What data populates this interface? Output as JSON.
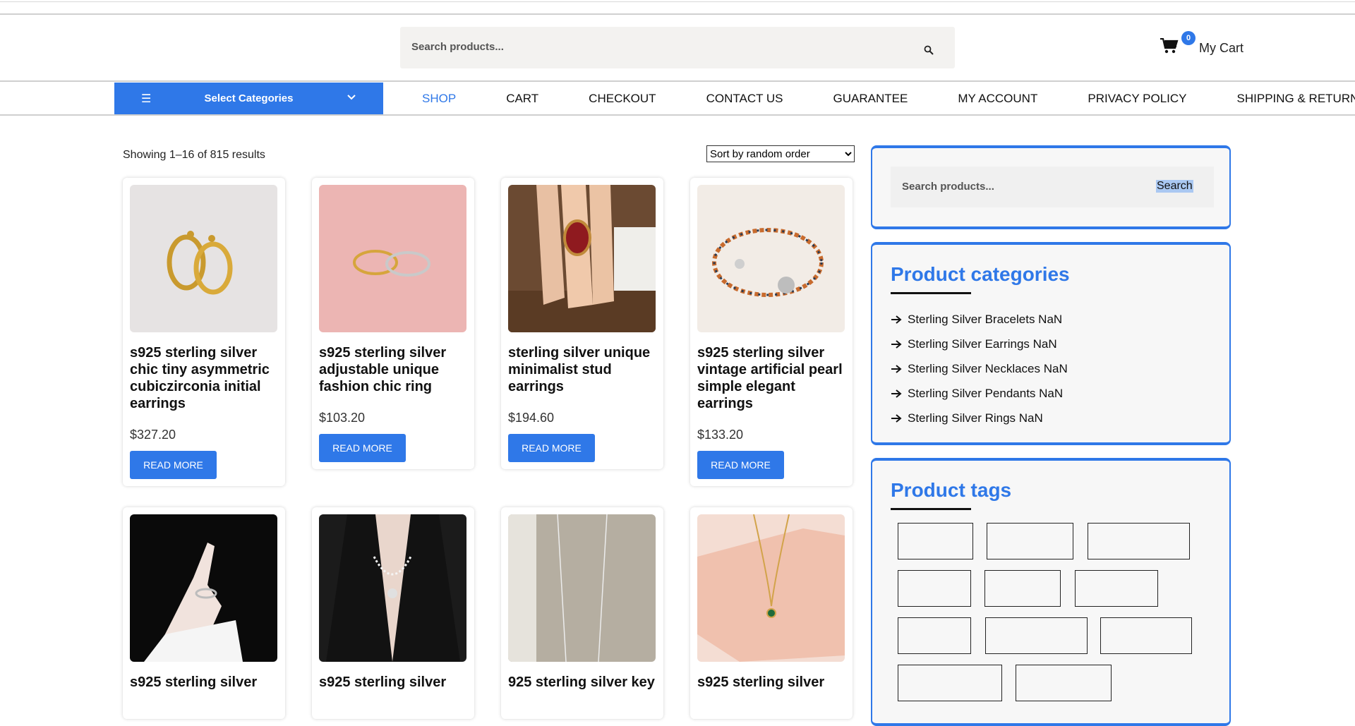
{
  "header": {
    "search_placeholder": "Search products...",
    "cart_count": "0",
    "cart_label": "My Cart"
  },
  "categories_button": {
    "label": "Select Categories"
  },
  "nav": {
    "items": [
      {
        "label": "SHOP",
        "active": true
      },
      {
        "label": "CART"
      },
      {
        "label": "CHECKOUT"
      },
      {
        "label": "CONTACT US"
      },
      {
        "label": "GUARANTEE"
      },
      {
        "label": "MY ACCOUNT"
      },
      {
        "label": "PRIVACY POLICY"
      },
      {
        "label": "SHIPPING & RETURN"
      }
    ]
  },
  "results": {
    "showing": "Showing 1–16 of 815 results",
    "sort_selected": "Sort by random order"
  },
  "products": [
    {
      "title": "s925 sterling silver chic tiny asymmetric cubiczirconia initial earrings",
      "price": "$327.20",
      "button": "READ MORE"
    },
    {
      "title": "s925 sterling silver adjustable unique fashion chic ring",
      "price": "$103.20",
      "button": "READ MORE"
    },
    {
      "title": "sterling silver unique minimalist stud earrings",
      "price": "$194.60",
      "button": "READ MORE"
    },
    {
      "title": "s925 sterling silver vintage artificial pearl simple elegant earrings",
      "price": "$133.20",
      "button": "READ MORE"
    },
    {
      "title": "s925 sterling silver"
    },
    {
      "title": "s925 sterling silver"
    },
    {
      "title": "925 sterling silver key"
    },
    {
      "title": "s925 sterling silver"
    }
  ],
  "sidebar": {
    "search": {
      "placeholder": "Search products...",
      "button": "Search"
    },
    "categories": {
      "title": "Product categories",
      "items": [
        "Sterling Silver Bracelets NaN",
        "Sterling Silver Earrings NaN",
        "Sterling Silver Necklaces NaN",
        "Sterling Silver Pendants NaN",
        "Sterling Silver Rings NaN"
      ]
    },
    "tags": {
      "title": "Product tags"
    }
  },
  "colors": {
    "accent": "#2f78e8",
    "text": "#111111",
    "widget_bg": "#f7f7f7"
  }
}
